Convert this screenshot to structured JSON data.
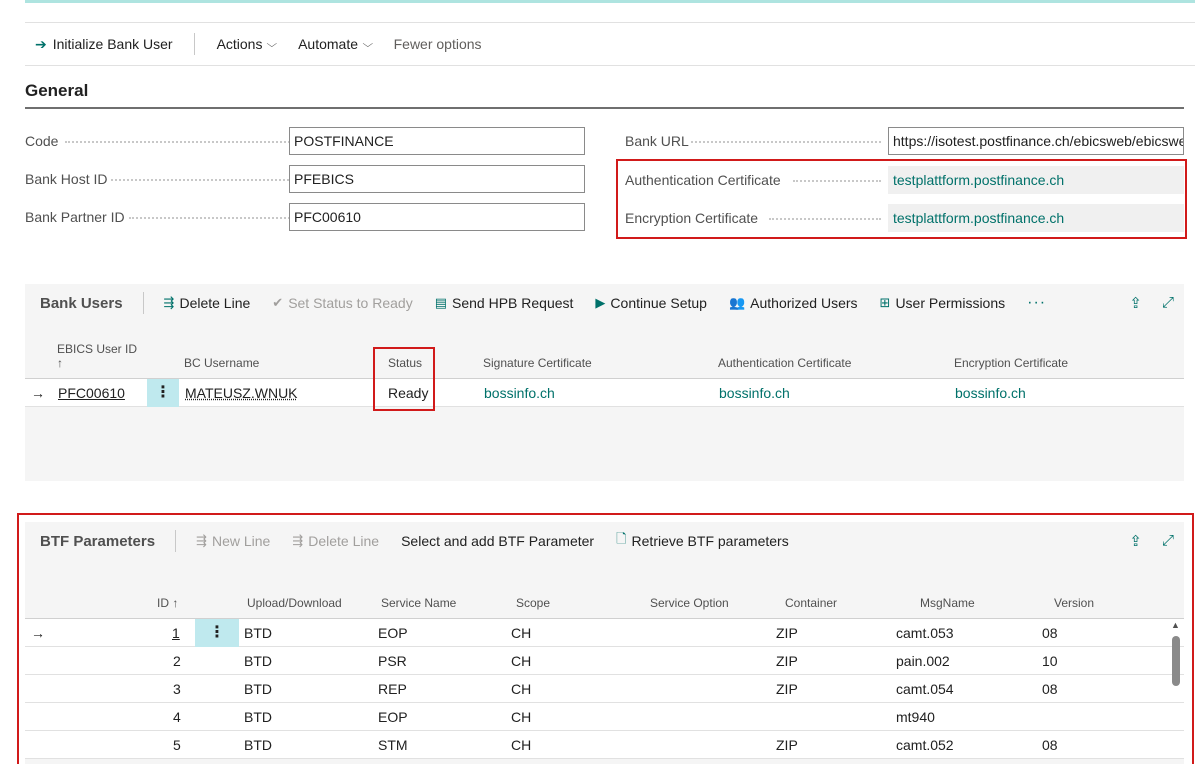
{
  "action_bar": {
    "initialize_label": "Initialize Bank User",
    "actions_label": "Actions",
    "automate_label": "Automate",
    "fewer_options_label": "Fewer options"
  },
  "general": {
    "title": "General",
    "code_label": "Code",
    "code_value": "POSTFINANCE",
    "bank_host_id_label": "Bank Host ID",
    "bank_host_id_value": "PFEBICS",
    "bank_partner_id_label": "Bank Partner ID",
    "bank_partner_id_value": "PFC00610",
    "bank_url_label": "Bank URL",
    "bank_url_value": "https://isotest.postfinance.ch/ebicsweb/ebicsweb",
    "auth_cert_label": "Authentication Certificate",
    "auth_cert_value": "testplattform.postfinance.ch",
    "enc_cert_label": "Encryption Certificate",
    "enc_cert_value": "testplattform.postfinance.ch"
  },
  "bank_users": {
    "title": "Bank Users",
    "toolbar": {
      "delete_line": "Delete Line",
      "set_status_ready": "Set Status to Ready",
      "send_hpb": "Send HPB Request",
      "continue_setup": "Continue Setup",
      "authorized_users": "Authorized Users",
      "user_permissions": "User Permissions",
      "more": "···"
    },
    "columns": {
      "ebics_user_id": "EBICS User ID",
      "sort_arrow": "↑",
      "bc_username": "BC Username",
      "status": "Status",
      "signature_cert": "Signature Certificate",
      "auth_cert": "Authentication Certificate",
      "enc_cert": "Encryption Certificate"
    },
    "rows": [
      {
        "ebics_user_id": "PFC00610",
        "bc_username": "MATEUSZ.WNUK",
        "status": "Ready",
        "signature_cert": "bossinfo.ch",
        "auth_cert": "bossinfo.ch",
        "enc_cert": "bossinfo.ch"
      }
    ]
  },
  "btf": {
    "title": "BTF Parameters",
    "toolbar": {
      "new_line": "New Line",
      "delete_line": "Delete Line",
      "select_add": "Select and add BTF Parameter",
      "retrieve": "Retrieve BTF parameters"
    },
    "columns": {
      "id": "ID ↑",
      "upload_download": "Upload/Download",
      "service_name": "Service Name",
      "scope": "Scope",
      "service_option": "Service Option",
      "container": "Container",
      "msgname": "MsgName",
      "version": "Version"
    },
    "rows": [
      {
        "id": "1",
        "updown": "BTD",
        "service": "EOP",
        "scope": "CH",
        "option": "",
        "container": "ZIP",
        "msgname": "camt.053",
        "version": "08"
      },
      {
        "id": "2",
        "updown": "BTD",
        "service": "PSR",
        "scope": "CH",
        "option": "",
        "container": "ZIP",
        "msgname": "pain.002",
        "version": "10"
      },
      {
        "id": "3",
        "updown": "BTD",
        "service": "REP",
        "scope": "CH",
        "option": "",
        "container": "ZIP",
        "msgname": "camt.054",
        "version": "08"
      },
      {
        "id": "4",
        "updown": "BTD",
        "service": "EOP",
        "scope": "CH",
        "option": "",
        "container": "",
        "msgname": "mt940",
        "version": ""
      },
      {
        "id": "5",
        "updown": "BTD",
        "service": "STM",
        "scope": "CH",
        "option": "",
        "container": "ZIP",
        "msgname": "camt.052",
        "version": "08"
      }
    ]
  },
  "colors": {
    "accent_teal": "#00716a",
    "highlight_red": "#d11a1a",
    "kebab_bg": "#bfe9ee"
  }
}
